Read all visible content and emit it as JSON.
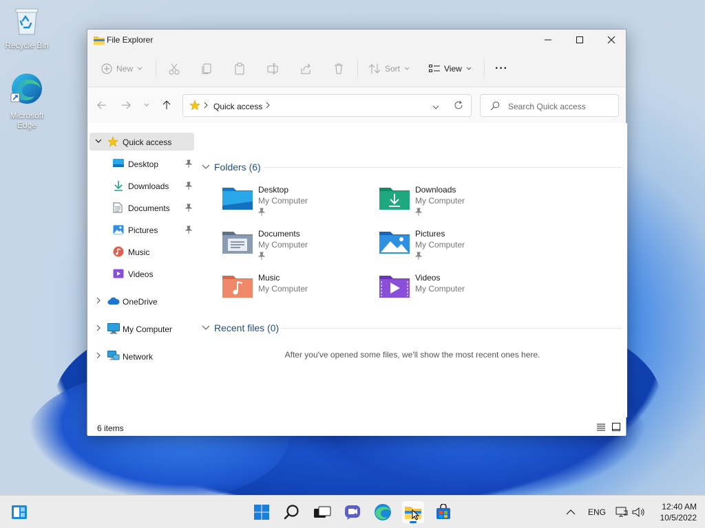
{
  "desktop": {
    "icons": [
      {
        "label": "Recycle Bin",
        "icon": "recycle-bin-icon"
      },
      {
        "label": "Microsoft Edge",
        "icon": "edge-icon"
      }
    ]
  },
  "window": {
    "title": "File Explorer",
    "controls": {
      "minimize": "minimize-icon",
      "maximize": "maximize-icon",
      "close": "close-icon"
    }
  },
  "toolbar": {
    "new_label": "New",
    "sort_label": "Sort",
    "view_label": "View",
    "more_glyph": "···"
  },
  "address": {
    "location": "Quick access",
    "search_placeholder": "Search Quick access"
  },
  "sidebar": {
    "quick_access": "Quick access",
    "pinned": [
      {
        "label": "Desktop",
        "pinned": true
      },
      {
        "label": "Downloads",
        "pinned": true
      },
      {
        "label": "Documents",
        "pinned": true
      },
      {
        "label": "Pictures",
        "pinned": true
      },
      {
        "label": "Music",
        "pinned": false
      },
      {
        "label": "Videos",
        "pinned": false
      }
    ],
    "onedrive": "OneDrive",
    "my_computer": "My Computer",
    "network": "Network"
  },
  "content": {
    "folders_header": "Folders (6)",
    "folders": [
      {
        "name": "Desktop",
        "location": "My Computer",
        "pinned": true
      },
      {
        "name": "Downloads",
        "location": "My Computer",
        "pinned": true
      },
      {
        "name": "Documents",
        "location": "My Computer",
        "pinned": true
      },
      {
        "name": "Pictures",
        "location": "My Computer",
        "pinned": true
      },
      {
        "name": "Music",
        "location": "My Computer",
        "pinned": false
      },
      {
        "name": "Videos",
        "location": "My Computer",
        "pinned": false
      }
    ],
    "recent_header": "Recent files (0)",
    "recent_empty": "After you've opened some files, we'll show the most recent ones here."
  },
  "status": {
    "item_count": "6 items"
  },
  "taskbar": {
    "language": "ENG",
    "time": "12:40 AM",
    "date": "10/5/2022"
  },
  "colors": {
    "accent": "#1b6fd1",
    "folder_blue": "#2aa7e8",
    "folder_green": "#1fa87e",
    "folder_gray": "#7c8fa6",
    "folder_orange": "#f0896a",
    "folder_purple": "#8a4fd8"
  }
}
